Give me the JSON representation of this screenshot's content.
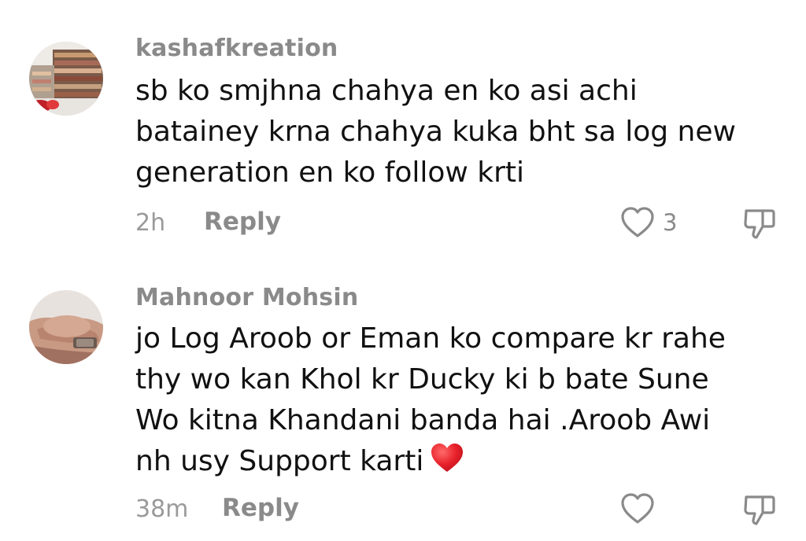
{
  "comments": [
    {
      "username": "kashafkreation",
      "text_lines": [
        "sb ko smjhna chahya en ko asi achi",
        "batainey krna chahya kuka bht sa log new",
        "generation en ko follow krti"
      ],
      "timestamp": "2h",
      "reply_label": "Reply",
      "like_count": "3",
      "avatar_icon": "store-shelves-photo"
    },
    {
      "username": "Mahnoor Mohsin",
      "text_lines": [
        "jo Log Aroob or Eman ko compare kr rahe",
        "thy wo kan Khol kr Ducky ki b bate Sune",
        "Wo kitna Khandani banda hai .Aroob Awi",
        "nh usy Support karti"
      ],
      "trailing_emoji": "red-heart-emoji",
      "timestamp": "38m",
      "reply_label": "Reply",
      "like_count": "",
      "avatar_icon": "holding-hands-photo"
    }
  ],
  "colors": {
    "text": "#111111",
    "muted": "#8a8a8a",
    "heart": "#e8212b"
  }
}
